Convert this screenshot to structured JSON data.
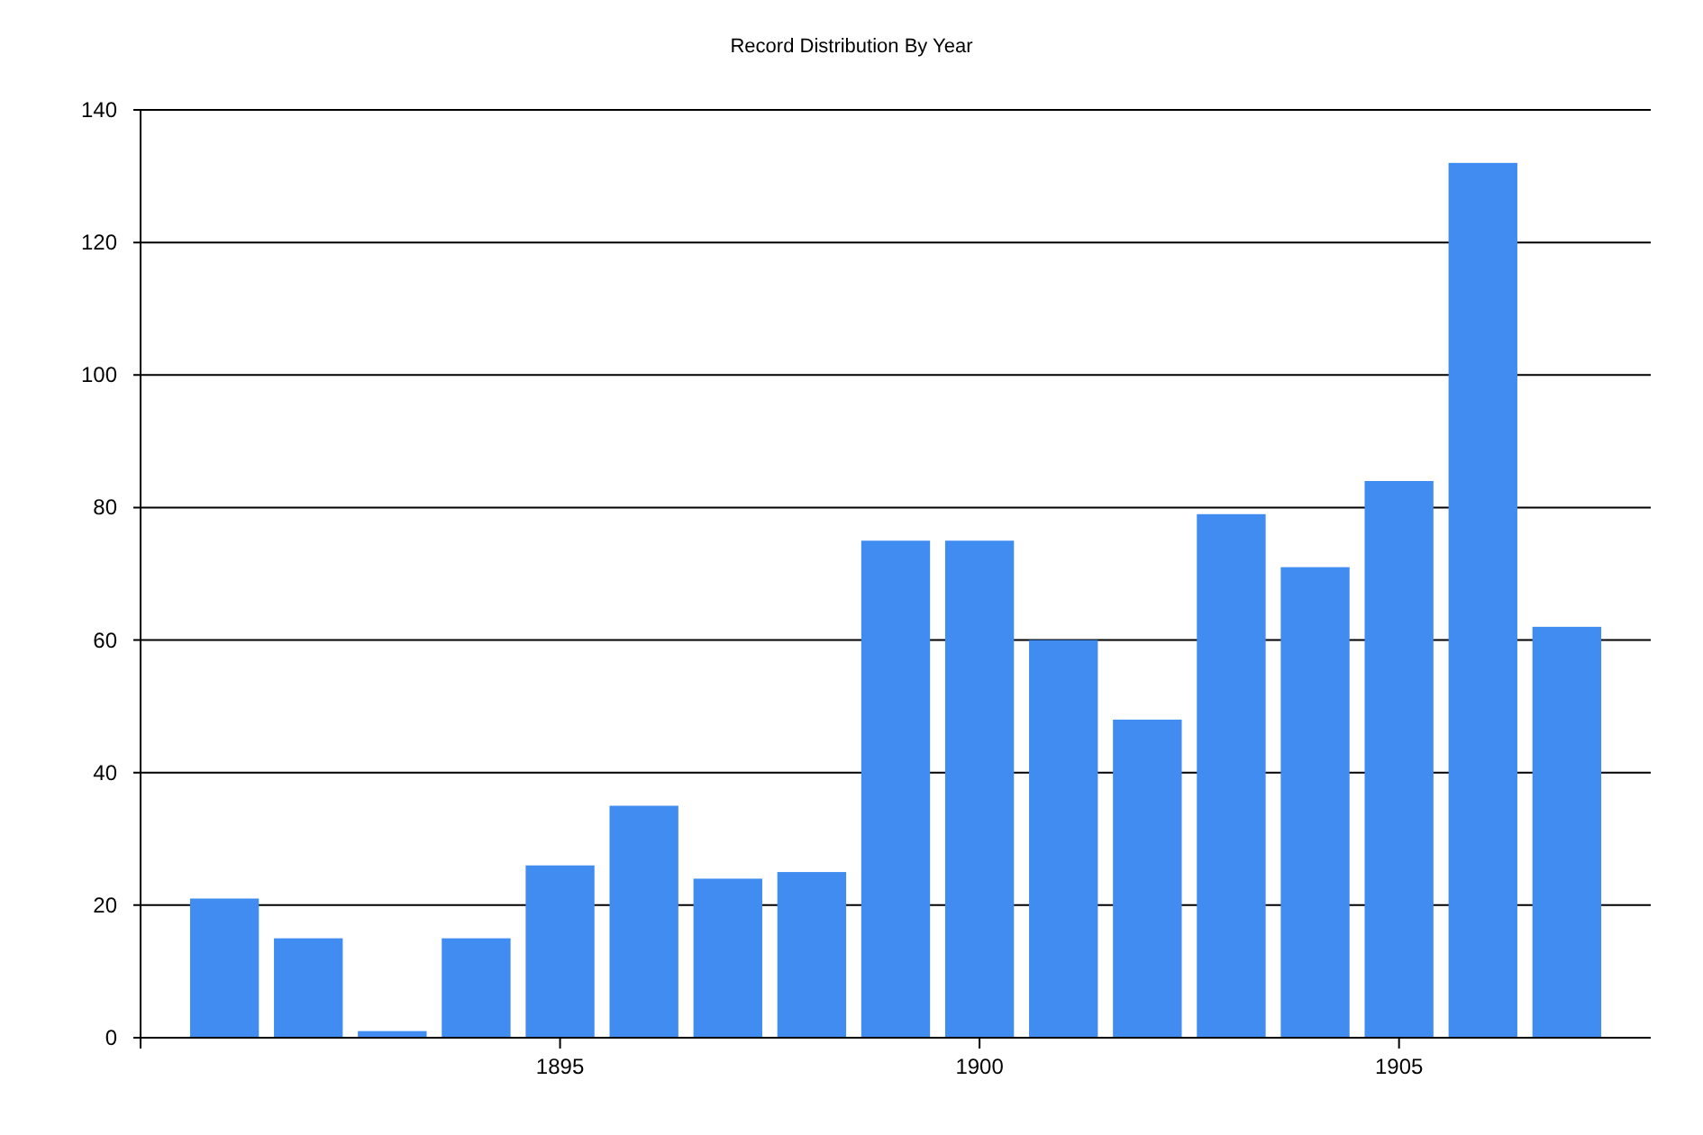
{
  "chart": {
    "chart_data": {
      "type": "bar",
      "title": "Record Distribution By Year",
      "x": [
        1891,
        1892,
        1893,
        1894,
        1895,
        1896,
        1897,
        1898,
        1899,
        1900,
        1901,
        1902,
        1903,
        1904,
        1905,
        1906,
        1907
      ],
      "values": [
        21,
        15,
        1,
        15,
        26,
        35,
        24,
        25,
        75,
        75,
        60,
        48,
        79,
        71,
        84,
        132,
        62
      ],
      "xlim": [
        1890,
        1908
      ],
      "ylim": [
        0,
        140
      ],
      "xticks": [
        1895,
        1900,
        1905
      ],
      "yticks": [
        0,
        20,
        40,
        60,
        80,
        100,
        120,
        140
      ],
      "grid": true
    }
  }
}
